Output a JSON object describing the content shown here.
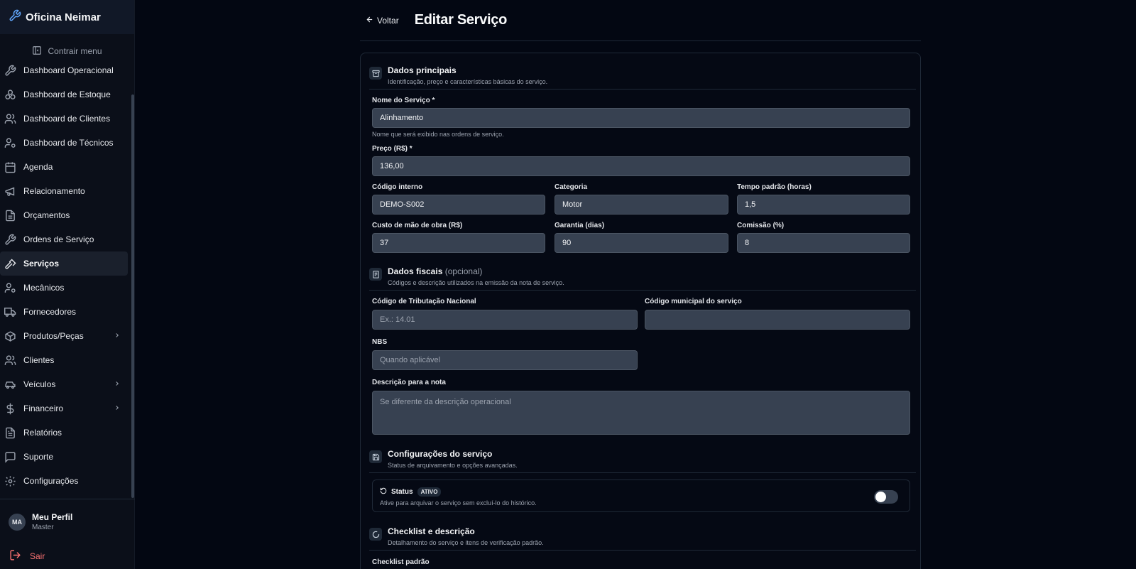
{
  "sidebar": {
    "brand": "Oficina Neimar",
    "collapse_label": "Contrair menu",
    "items": [
      {
        "label": "Dashboard Operacional",
        "icon": "wrench-icon"
      },
      {
        "label": "Dashboard de Estoque",
        "icon": "boxes-icon"
      },
      {
        "label": "Dashboard de Clientes",
        "icon": "users-icon"
      },
      {
        "label": "Dashboard de Técnicos",
        "icon": "user-cog-icon"
      },
      {
        "label": "Agenda",
        "icon": "calendar-icon"
      },
      {
        "label": "Relacionamento",
        "icon": "megaphone-icon"
      },
      {
        "label": "Orçamentos",
        "icon": "file-icon"
      },
      {
        "label": "Ordens de Serviço",
        "icon": "wrench-icon"
      },
      {
        "label": "Serviços",
        "icon": "hammer-icon"
      },
      {
        "label": "Mecânicos",
        "icon": "user-cog-icon"
      },
      {
        "label": "Fornecedores",
        "icon": "truck-icon"
      },
      {
        "label": "Produtos/Peças",
        "icon": "package-icon"
      },
      {
        "label": "Clientes",
        "icon": "users-icon"
      },
      {
        "label": "Veículos",
        "icon": "car-icon"
      },
      {
        "label": "Financeiro",
        "icon": "dollar-icon"
      },
      {
        "label": "Relatórios",
        "icon": "file-text-icon"
      },
      {
        "label": "Suporte",
        "icon": "message-icon"
      },
      {
        "label": "Configurações",
        "icon": "gear-icon"
      }
    ],
    "profile": {
      "initials": "MA",
      "name": "Meu Perfil",
      "role": "Master"
    },
    "logout_label": "Sair"
  },
  "header": {
    "back_label": "Voltar",
    "title": "Editar Serviço"
  },
  "sections": {
    "main": {
      "title": "Dados principais",
      "desc": "Identificação, preço e características básicas do serviço."
    },
    "fiscal": {
      "title": "Dados fiscais",
      "optional": "(opcional)",
      "desc": "Códigos e descrição utilizados na emissão da nota de serviço."
    },
    "config": {
      "title": "Configurações do serviço",
      "desc": "Status de arquivamento e opções avançadas."
    },
    "checklist": {
      "title": "Checklist e descrição",
      "desc": "Detalhamento do serviço e itens de verificação padrão."
    }
  },
  "fields": {
    "name": {
      "label": "Nome do Serviço *",
      "value": "Alinhamento",
      "help": "Nome que será exibido nas ordens de serviço."
    },
    "price": {
      "label": "Preço (R$) *",
      "value": "136,00"
    },
    "code": {
      "label": "Código interno",
      "value": "DEMO-S002"
    },
    "category": {
      "label": "Categoria",
      "value": "Motor"
    },
    "time": {
      "label": "Tempo padrão (horas)",
      "value": "1,5"
    },
    "labor": {
      "label": "Custo de mão de obra (R$)",
      "value": "37"
    },
    "warranty": {
      "label": "Garantia (dias)",
      "value": "90"
    },
    "commission": {
      "label": "Comissão (%)",
      "value": "8"
    },
    "tax_code": {
      "label": "Código de Tributação Nacional",
      "placeholder": "Ex.: 14.01"
    },
    "municipal_code": {
      "label": "Código municipal do serviço",
      "placeholder": ""
    },
    "nbs": {
      "label": "NBS",
      "placeholder": "Quando aplicável"
    },
    "note_desc": {
      "label": "Descrição para a nota",
      "placeholder": "Se diferente da descrição operacional"
    }
  },
  "status": {
    "title": "Status",
    "badge": "ATIVO",
    "desc": "Ative para arquivar o serviço sem excluí-lo do histórico.",
    "archived": false
  },
  "checklist": {
    "label": "Checklist padrão"
  }
}
